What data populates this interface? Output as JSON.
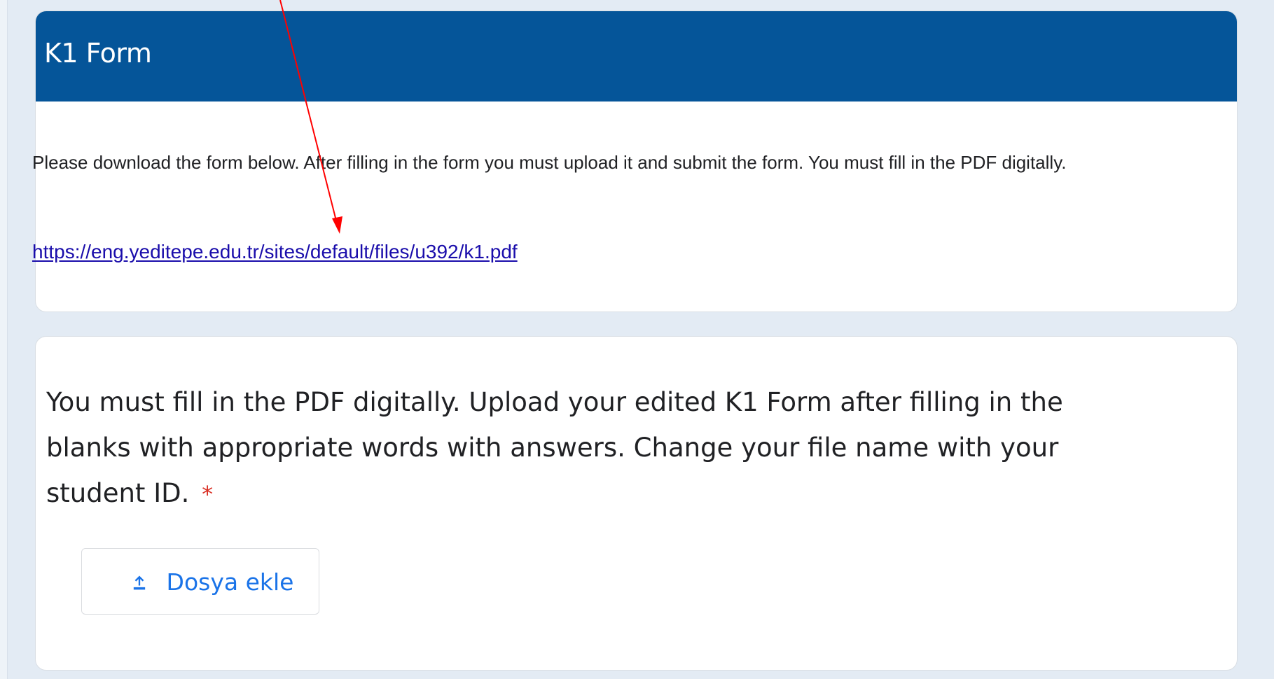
{
  "form": {
    "title": "K1 Form",
    "description": "Please download the form below. After filling in the form you must upload it and submit the form. You must fill in the PDF digitally.",
    "link_text": "https://eng.yeditepe.edu.tr/sites/default/files/u392/k1.pdf"
  },
  "question": {
    "text": "You must fill in the PDF digitally. Upload your edited K1 Form after filling in the blanks with appropriate words with answers. Change your file name with your student ID.",
    "required_marker": "*",
    "upload_button_label": "Dosya ekle",
    "upload_icon": "upload-icon"
  },
  "colors": {
    "header_blue": "#055599",
    "page_background": "#e3ebf4",
    "link": "#1a0dab",
    "button_text": "#1a73e8",
    "required": "#d93025",
    "annotation_arrow": "#ff0000"
  }
}
